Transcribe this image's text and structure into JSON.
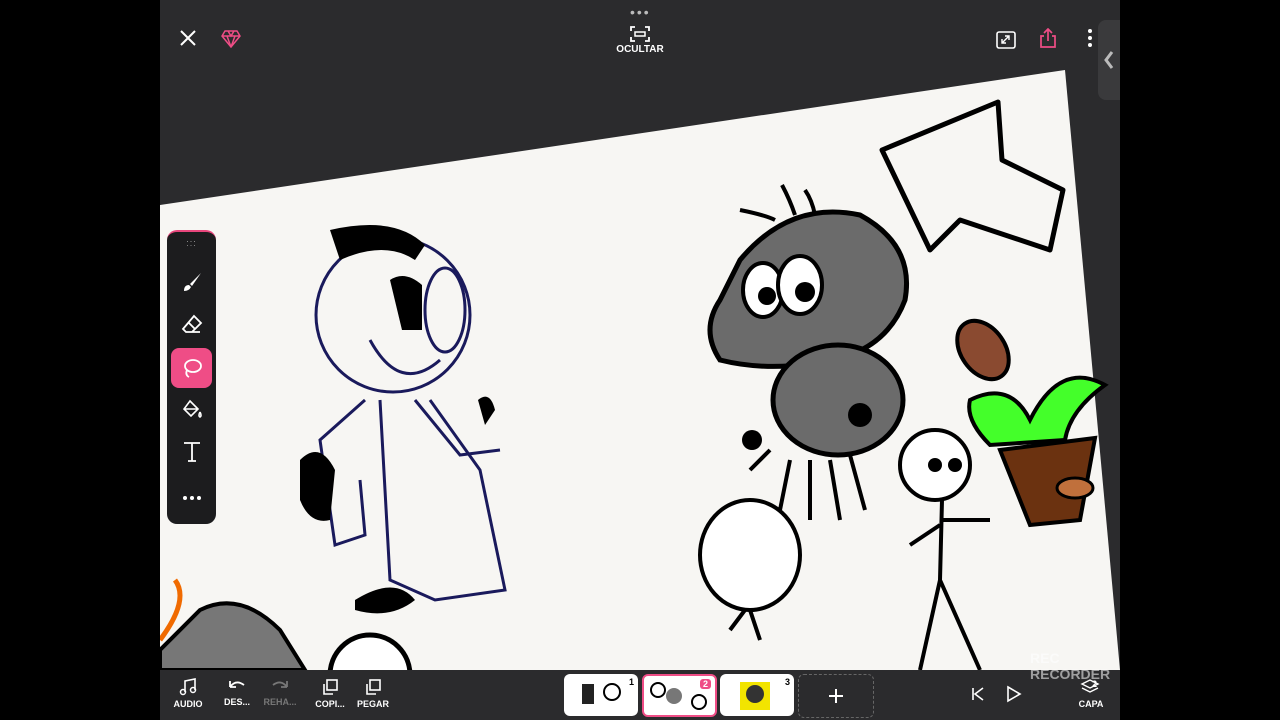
{
  "topbar": {
    "hide_label": "OCULTAR"
  },
  "tools": [
    "brush",
    "eraser",
    "lasso",
    "fill",
    "text",
    "more"
  ],
  "bottombar": {
    "audio_label": "AUDIO",
    "undo_label": "DES...",
    "redo_label": "REHA...",
    "copy_label": "COPI...",
    "paste_label": "PEGAR",
    "layer_label": "CAPA",
    "layer_count": "2"
  },
  "frames": [
    {
      "number": "1"
    },
    {
      "number": "2"
    },
    {
      "number": "3"
    }
  ],
  "watermark": "REC RECORDER",
  "colors": {
    "accent": "#ef4d86",
    "background": "#2b2b2d",
    "paper": "#f7f6f3"
  }
}
